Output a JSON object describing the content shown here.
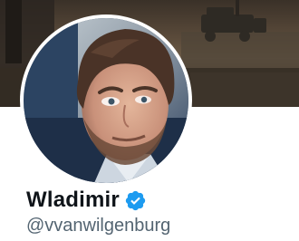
{
  "profile": {
    "display_name": "Wladimir",
    "handle": "@vvanwilgenburg",
    "verified": true,
    "verified_icon": "verified-badge-icon",
    "verified_color": "#1d9bf0",
    "name_color": "#0f1419",
    "handle_color": "#536471"
  },
  "banner": {
    "image": "banner-photo"
  },
  "avatar": {
    "image": "avatar-photo"
  }
}
